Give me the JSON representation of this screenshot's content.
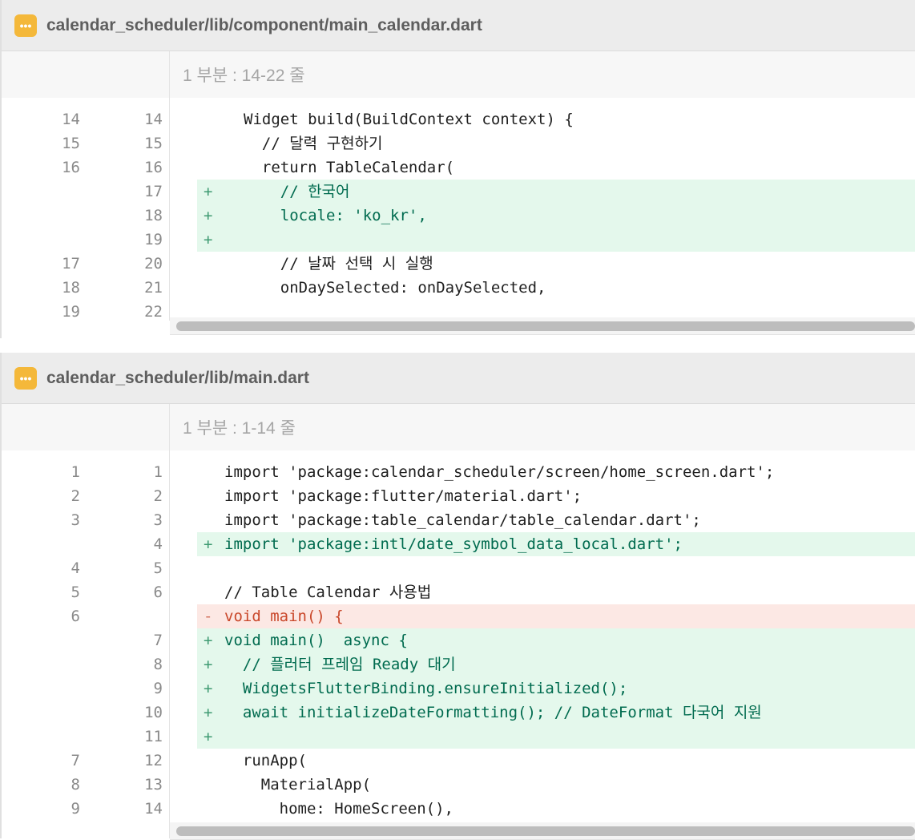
{
  "files": [
    {
      "path": "calendar_scheduler/lib/component/main_calendar.dart",
      "icon": "ellipsis-icon",
      "icon_glyph": "•••",
      "hunk_label": "1 부분 : 14-22 줄",
      "lines": [
        {
          "old": "14",
          "new": "14",
          "type": "ctx",
          "mark": "",
          "text": "Widget build(BuildContext context) {"
        },
        {
          "old": "15",
          "new": "15",
          "type": "ctx",
          "mark": "",
          "text": "  // 달력 구현하기"
        },
        {
          "old": "16",
          "new": "16",
          "type": "ctx",
          "mark": "",
          "text": "  return TableCalendar("
        },
        {
          "old": "",
          "new": "17",
          "type": "add",
          "mark": "+",
          "text": "    // 한국어"
        },
        {
          "old": "",
          "new": "18",
          "type": "add",
          "mark": "+",
          "text": "    locale: 'ko_kr',"
        },
        {
          "old": "",
          "new": "19",
          "type": "add",
          "mark": "+",
          "text": ""
        },
        {
          "old": "17",
          "new": "20",
          "type": "ctx",
          "mark": "",
          "text": "    // 날짜 선택 시 실행"
        },
        {
          "old": "18",
          "new": "21",
          "type": "ctx",
          "mark": "",
          "text": "    onDaySelected: onDaySelected,"
        },
        {
          "old": "19",
          "new": "22",
          "type": "ctx",
          "mark": "",
          "text": ""
        }
      ]
    },
    {
      "path": "calendar_scheduler/lib/main.dart",
      "icon": "ellipsis-icon",
      "icon_glyph": "•••",
      "hunk_label": "1 부분 : 1-14 줄",
      "lines": [
        {
          "old": "1",
          "new": "1",
          "type": "ctx",
          "mark": "",
          "text": "import 'package:calendar_scheduler/screen/home_screen.dart';"
        },
        {
          "old": "2",
          "new": "2",
          "type": "ctx",
          "mark": "",
          "text": "import 'package:flutter/material.dart';"
        },
        {
          "old": "3",
          "new": "3",
          "type": "ctx",
          "mark": "",
          "text": "import 'package:table_calendar/table_calendar.dart';"
        },
        {
          "old": "",
          "new": "4",
          "type": "add",
          "mark": "+",
          "text": "import 'package:intl/date_symbol_data_local.dart';"
        },
        {
          "old": "4",
          "new": "5",
          "type": "ctx",
          "mark": "",
          "text": ""
        },
        {
          "old": "5",
          "new": "6",
          "type": "ctx",
          "mark": "",
          "text": "// Table Calendar 사용법"
        },
        {
          "old": "6",
          "new": "",
          "type": "del",
          "mark": "-",
          "text": "void main() {"
        },
        {
          "old": "",
          "new": "7",
          "type": "add",
          "mark": "+",
          "text": "void main()  async {"
        },
        {
          "old": "",
          "new": "8",
          "type": "add",
          "mark": "+",
          "text": "  // 플러터 프레임 Ready 대기"
        },
        {
          "old": "",
          "new": "9",
          "type": "add",
          "mark": "+",
          "text": "  WidgetsFlutterBinding.ensureInitialized();"
        },
        {
          "old": "",
          "new": "10",
          "type": "add",
          "mark": "+",
          "text": "  await initializeDateFormatting(); // DateFormat 다국어 지원"
        },
        {
          "old": "",
          "new": "11",
          "type": "add",
          "mark": "+",
          "text": ""
        },
        {
          "old": "7",
          "new": "12",
          "type": "ctx",
          "mark": "",
          "text": "  runApp("
        },
        {
          "old": "8",
          "new": "13",
          "type": "ctx",
          "mark": "",
          "text": "    MaterialApp("
        },
        {
          "old": "9",
          "new": "14",
          "type": "ctx",
          "mark": "",
          "text": "      home: HomeScreen(),"
        }
      ]
    }
  ],
  "colors": {
    "added_bg": "#e4f8ec",
    "added_text": "#006b4f",
    "removed_bg": "#fce8e4",
    "removed_text": "#c9472a",
    "icon_bg": "#f4b83a"
  }
}
